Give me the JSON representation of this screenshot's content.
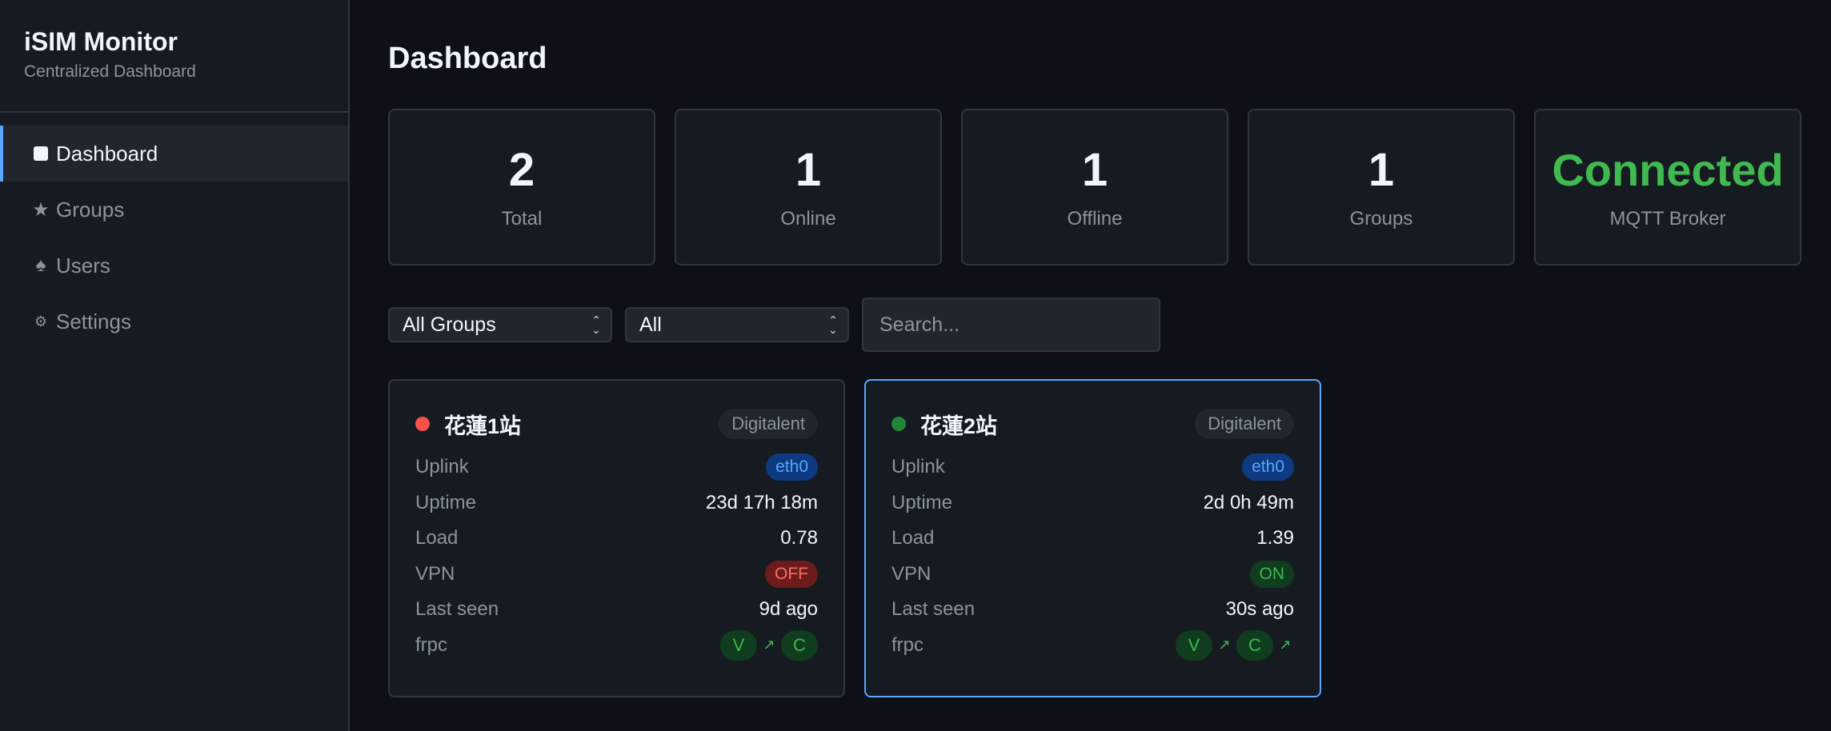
{
  "sidebar": {
    "title": "iSIM Monitor",
    "subtitle": "Centralized Dashboard",
    "items": [
      {
        "label": "Dashboard",
        "icon": "square-icon"
      },
      {
        "label": "Groups",
        "icon": "star-icon"
      },
      {
        "label": "Users",
        "icon": "spade-icon"
      },
      {
        "label": "Settings",
        "icon": "gear-icon"
      }
    ]
  },
  "main": {
    "title": "Dashboard",
    "stats": [
      {
        "value": "2",
        "label": "Total"
      },
      {
        "value": "1",
        "label": "Online"
      },
      {
        "value": "1",
        "label": "Offline"
      },
      {
        "value": "1",
        "label": "Groups"
      },
      {
        "value": "Connected",
        "label": "MQTT Broker"
      }
    ],
    "filters": {
      "group_select": "All Groups",
      "status_select": "All",
      "search_placeholder": "Search..."
    },
    "devices": [
      {
        "name": "花蓮1站",
        "status": "offline",
        "group": "Digitalent",
        "uplink_label": "Uplink",
        "uplink": "eth0",
        "uptime_label": "Uptime",
        "uptime": "23d 17h 18m",
        "load_label": "Load",
        "load": "0.78",
        "vpn_label": "VPN",
        "vpn": "OFF",
        "last_seen_label": "Last seen",
        "last_seen": "9d ago",
        "frpc_label": "frpc",
        "frpc_v": "V",
        "frpc_c": "C"
      },
      {
        "name": "花蓮2站",
        "status": "online",
        "group": "Digitalent",
        "uplink_label": "Uplink",
        "uplink": "eth0",
        "uptime_label": "Uptime",
        "uptime": "2d 0h 49m",
        "load_label": "Load",
        "load": "1.39",
        "vpn_label": "VPN",
        "vpn": "ON",
        "last_seen_label": "Last seen",
        "last_seen": "30s ago",
        "frpc_label": "frpc",
        "frpc_v": "V",
        "frpc_c": "C"
      }
    ]
  },
  "colors": {
    "accent": "#58a6ff",
    "online": "#238636",
    "offline": "#f85149",
    "connected": "#3fb950"
  }
}
